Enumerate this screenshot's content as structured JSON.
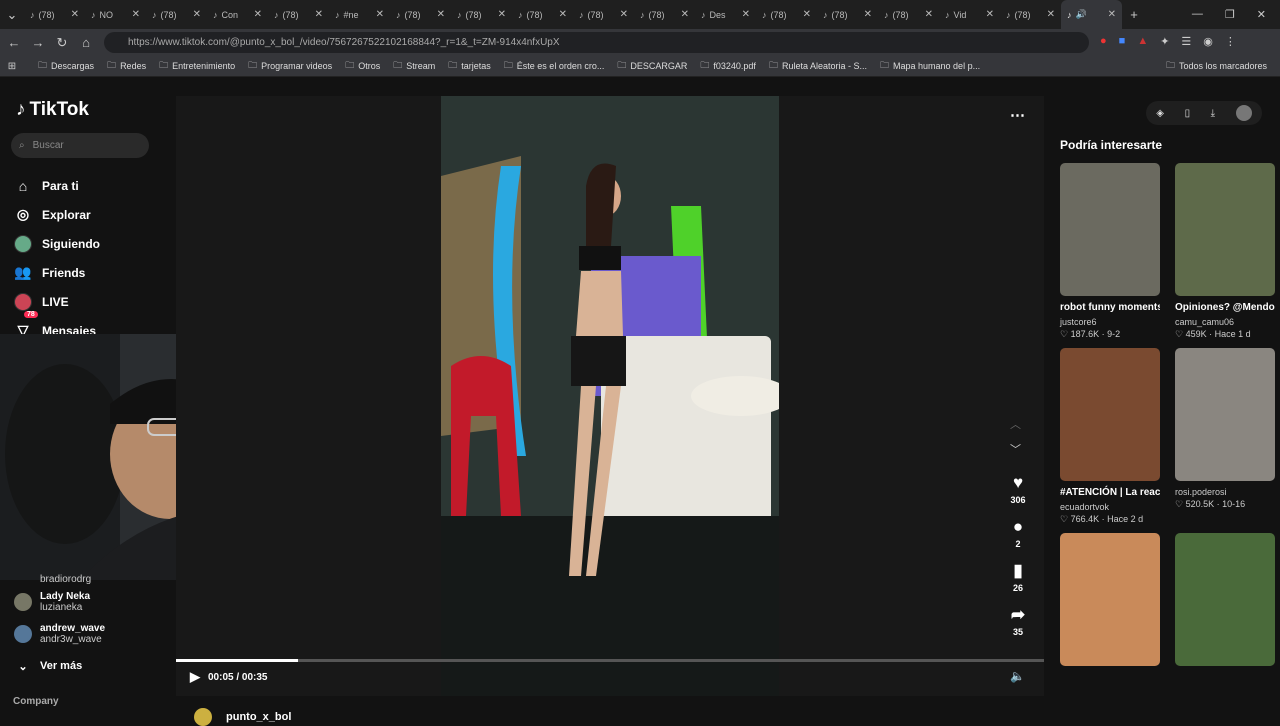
{
  "browser": {
    "tabs": [
      {
        "label": "(78)"
      },
      {
        "label": "NO"
      },
      {
        "label": "(78)"
      },
      {
        "label": "Con"
      },
      {
        "label": "(78)"
      },
      {
        "label": "#ne"
      },
      {
        "label": "(78)"
      },
      {
        "label": "(78)"
      },
      {
        "label": "(78)"
      },
      {
        "label": "(78)"
      },
      {
        "label": "(78)"
      },
      {
        "label": "Des"
      },
      {
        "label": "(78)"
      },
      {
        "label": "(78)"
      },
      {
        "label": "(78)"
      },
      {
        "label": "Vid"
      },
      {
        "label": "(78)"
      }
    ],
    "url": "https://www.tiktok.com/@punto_x_bol_/video/7567267522102168844?_r=1&_t=ZM-914x4nfxUpX",
    "bookmarks": [
      "Descargas",
      "Redes",
      "Entretenimiento",
      "Programar videos",
      "Otros",
      "Stream",
      "tarjetas",
      "Éste es el orden cro...",
      "DESCARGAR",
      "f03240.pdf",
      "Ruleta Aleatoria - S...",
      "Mapa humano del p..."
    ],
    "all_bookmarks": "Todos los marcadores"
  },
  "sidebar": {
    "logo": "TikTok",
    "search_placeholder": "Buscar",
    "items": [
      {
        "label": "Para ti"
      },
      {
        "label": "Explorar"
      },
      {
        "label": "Siguiendo"
      },
      {
        "label": "Friends"
      },
      {
        "label": "LIVE"
      },
      {
        "label": "Mensajes"
      }
    ],
    "messages_badge": "78",
    "following": [
      {
        "name": "bradiorodrg",
        "sub": ""
      },
      {
        "name": "Lady Neka",
        "sub": "luzianeka"
      },
      {
        "name": "andrew_wave",
        "sub": "andr3w_wave"
      }
    ],
    "more": "Ver más",
    "company": "Company"
  },
  "player": {
    "time": "00:05 / 00:35",
    "progress": 0.14,
    "likes": "306",
    "comments": "2",
    "saves": "26",
    "shares": "35",
    "author": "punto_x_bol"
  },
  "right": {
    "title": "Podría interesarte",
    "cards": [
      {
        "title": "robot funny moments and crash...",
        "author": "justcore6",
        "views": "187.6K",
        "date": "9-2",
        "color": "#6b6a60"
      },
      {
        "title": "Opiniones? @Mendoza Saomi...",
        "author": "camu_camu06",
        "views": "459K",
        "date": "Hace 1 d",
        "color": "#5e6a4a"
      },
      {
        "title": "#ATENCIÓN | La reacción de este to...",
        "author": "ecuadortvok",
        "views": "766.4K",
        "date": "Hace 2 d",
        "color": "#7a4a30"
      },
      {
        "title": "",
        "author": "rosi.poderosi",
        "views": "520.5K",
        "date": "10-16",
        "color": "#8a8680"
      },
      {
        "title": "",
        "author": "",
        "views": "",
        "date": "",
        "color": "#c98a5a"
      },
      {
        "title": "",
        "author": "",
        "views": "",
        "date": "",
        "color": "#4a6a3a"
      }
    ]
  }
}
